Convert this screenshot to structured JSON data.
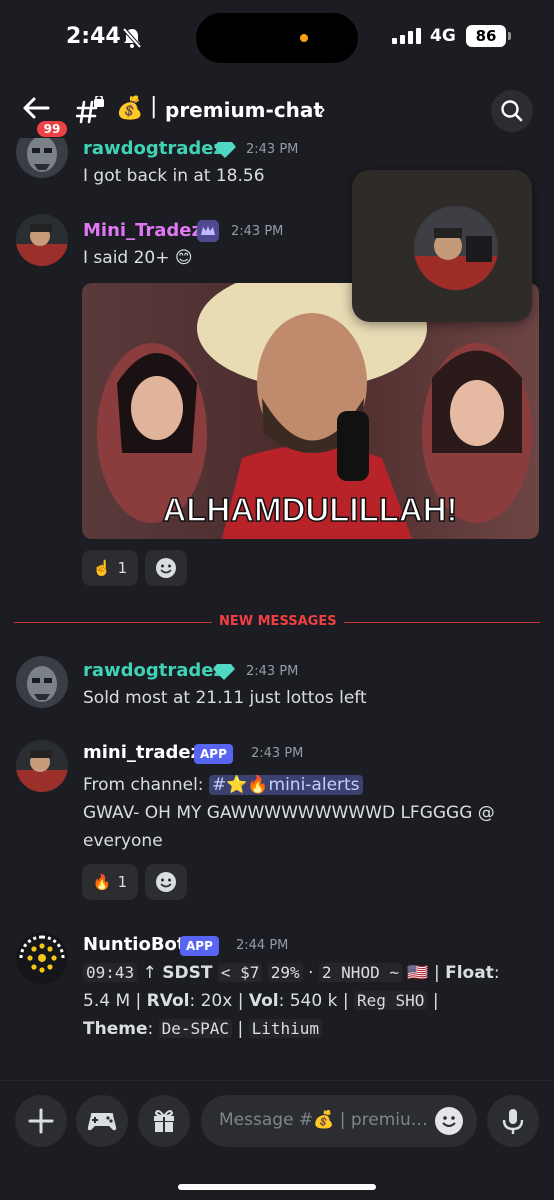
{
  "status_bar": {
    "time": "2:44",
    "network": "4G",
    "battery": "86"
  },
  "header": {
    "unread_badge": "99",
    "channel_emoji": "💰",
    "separator": "|",
    "channel_name": "premium-chat",
    "chevron": "›"
  },
  "messages": [
    {
      "username": "rawdogtradez",
      "timestamp": "2:43 PM",
      "text": "I got back in at 18.56",
      "name_color": "#3fd3b5"
    },
    {
      "username": "Mini_Tradez",
      "timestamp": "2:43 PM",
      "text": "I said 20+ 😊",
      "name_color": "#e078f5",
      "gif_caption": "ALHAMDULILLAH!",
      "reactions": [
        {
          "emoji": "☝️",
          "count": "1"
        }
      ]
    },
    {
      "username": "rawdogtradez",
      "timestamp": "2:43 PM",
      "text": "Sold most at 21.11 just lottos left",
      "name_color": "#3fd3b5"
    },
    {
      "username": "mini_tradez",
      "badge": "APP",
      "timestamp": "2:43 PM",
      "name_color": "#ffffff",
      "line1_prefix": "From channel:",
      "mention": "#⭐🔥mini-alerts",
      "line2": "GWAV- OH MY GAWWWWWWWWWD LFGGGG @",
      "line3": "everyone",
      "reactions": [
        {
          "emoji": "🔥",
          "count": "1"
        }
      ]
    },
    {
      "username": "NuntioBot",
      "badge": "APP",
      "timestamp": "2:44 PM",
      "name_color": "#ffffff",
      "l1": {
        "time": "09:43",
        "arrow": "↑",
        "ticker": "SDST",
        "price": "< $7",
        "pct": "29%",
        "dot": "·",
        "nhod": "2 NHOD ~",
        "flag": "🇺🇸",
        "sep": "|",
        "float_label": "Float",
        "colon": ":"
      },
      "l2": {
        "float_val": "5.4 M",
        "rvol_label": "RVol",
        "rvol_val": ": 20x",
        "vol_label": "Vol",
        "vol_val": ": 540 k",
        "reg": "Reg SHO",
        "sep": "|"
      },
      "l3": {
        "theme_label": "Theme",
        "colon": ":",
        "theme1": "De-SPAC",
        "sep": "|",
        "theme2": "Lithium"
      }
    }
  ],
  "divider": "NEW MESSAGES",
  "input": {
    "placeholder": "Message #💰 | premium-chat"
  },
  "icons": [
    "bell-slash-icon",
    "back-arrow-icon",
    "hash-lock-icon",
    "search-icon",
    "plus-icon",
    "gamepad-icon",
    "gift-icon",
    "emoji-icon",
    "microphone-icon",
    "add-reaction-icon"
  ]
}
